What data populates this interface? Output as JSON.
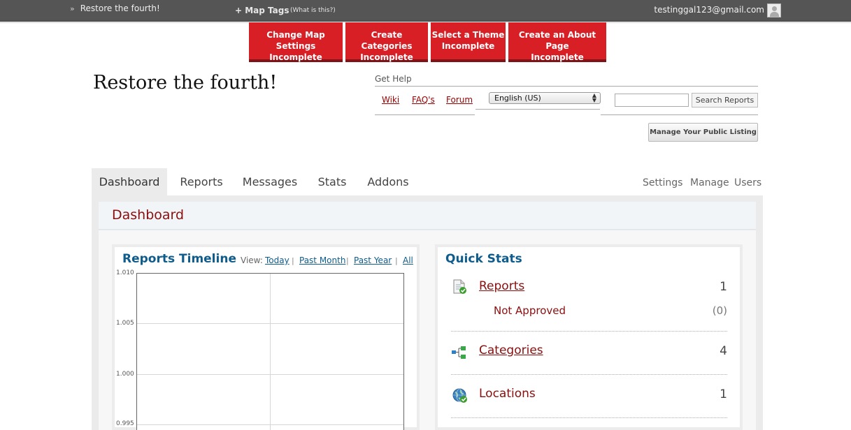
{
  "topbar": {
    "site_name": "Restore the fourth!",
    "map_tags_label": "+ Map Tags",
    "what_is_this": "(What is this?)",
    "user_email": "testinggal123@gmail.com"
  },
  "setup_tasks": [
    {
      "line1": "Change Map Settings",
      "line2": "Incomplete"
    },
    {
      "line1": "Create Categories",
      "line2": "Incomplete"
    },
    {
      "line1": "Select a Theme",
      "line2": "Incomplete"
    },
    {
      "line1": "Create an About Page",
      "line2": "Incomplete"
    }
  ],
  "header": {
    "site_title": "Restore the fourth!",
    "get_help": "Get Help",
    "help_links": [
      "Wiki",
      "FAQ's",
      "Forum"
    ],
    "language_selected": "English (US)",
    "search_value": "",
    "search_button": "Search Reports",
    "manage_listing_button": "Manage Your Public Listing"
  },
  "nav": {
    "tabs": [
      "Dashboard",
      "Reports",
      "Messages",
      "Stats",
      "Addons"
    ],
    "active_tab": "Dashboard",
    "sub_links": [
      "Settings",
      "Manage",
      "Users"
    ]
  },
  "dashboard": {
    "title": "Dashboard",
    "timeline": {
      "title": "Reports Timeline",
      "view_label": "View:",
      "view_links": [
        "Today",
        "Past Month",
        "Past Year",
        "All"
      ],
      "separator": "|"
    },
    "quick_stats": {
      "title": "Quick Stats",
      "reports_label": "Reports",
      "reports_count": "1",
      "not_approved_label": "Not Approved",
      "not_approved_count": "(0)",
      "categories_label": "Categories",
      "categories_count": "4",
      "locations_label": "Locations",
      "locations_count": "1"
    }
  },
  "chart_data": {
    "type": "line",
    "title": "",
    "xlabel": "",
    "ylabel": "",
    "y_ticks": [
      "1.010",
      "1.005",
      "1.000",
      "0.995"
    ],
    "ylim": [
      0.995,
      1.01
    ],
    "series": []
  },
  "colors": {
    "topbar": "#555555",
    "setup_red": "#d91f26",
    "title_red": "#8b0e0e",
    "heading_blue": "#0e5c8c"
  }
}
